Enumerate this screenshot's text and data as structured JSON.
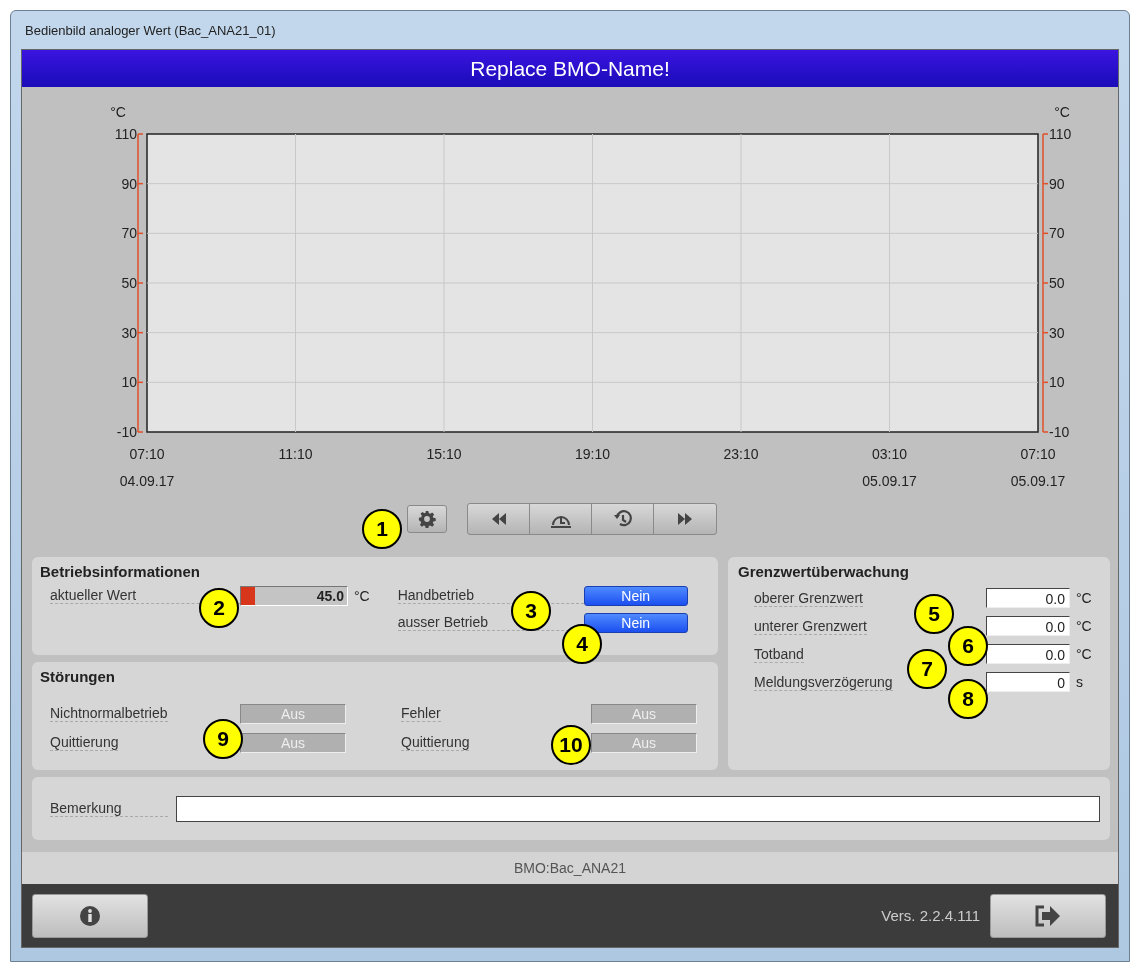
{
  "window": {
    "title": "Bedienbild analoger Wert (Bac_ANA21_01)"
  },
  "header": {
    "title": "Replace BMO-Name!"
  },
  "chart": {
    "unit_right": "°C",
    "right_yticks": [
      "110",
      "90",
      "70",
      "50",
      "30",
      "10",
      "-10"
    ],
    "chart_data": {
      "type": "line",
      "grid": true,
      "ylabel": "°C",
      "ylim": [
        -10,
        110
      ],
      "yticks": [
        -10,
        10,
        30,
        50,
        70,
        90,
        110
      ],
      "categories": [
        "07:10",
        "11:10",
        "15:10",
        "19:10",
        "23:10",
        "03:10",
        "07:10"
      ]
    },
    "date_labels": [
      {
        "text": "04.09.17",
        "kind": "first"
      },
      {
        "text": "05.09.17",
        "kind": "penultimate"
      },
      {
        "text": "05.09.17",
        "kind": "last"
      }
    ]
  },
  "betriebsinformationen": {
    "title": "Betriebsinformationen",
    "current_label": "aktueller Wert",
    "current_value": "45.0",
    "current_unit": "°C",
    "level": 0.13,
    "states": [
      {
        "label": "Handbetrieb",
        "value": "Nein"
      },
      {
        "label": "ausser Betrieb",
        "value": "Nein"
      }
    ]
  },
  "stoerungen": {
    "title": "Störungen",
    "items": [
      {
        "label": "Nichtnormalbetrieb",
        "value": "Aus"
      },
      {
        "label": "Quittierung",
        "value": "Aus"
      },
      {
        "label": "Fehler",
        "value": "Aus"
      },
      {
        "label": "Quittierung",
        "value": "Aus"
      }
    ]
  },
  "grenzwert": {
    "title": "Grenzwertüberwachung",
    "rows": [
      {
        "label": "oberer Grenzwert",
        "value": "0.0",
        "unit": "°C"
      },
      {
        "label": "unterer Grenzwert",
        "value": "0.0",
        "unit": "°C"
      },
      {
        "label": "Totband",
        "value": "0.0",
        "unit": "°C"
      },
      {
        "label": "Meldungsverzögerung",
        "value": "0",
        "unit": "s"
      }
    ]
  },
  "bemerkung": {
    "label": "Bemerkung"
  },
  "status_bar": "BMO:Bac_ANA21",
  "footer": {
    "version": "Vers. 2.2.4.111"
  },
  "callouts": [
    {
      "label": "1"
    },
    {
      "label": "2"
    },
    {
      "label": "3"
    },
    {
      "label": "4"
    },
    {
      "label": "5"
    },
    {
      "label": "6"
    },
    {
      "label": "7"
    },
    {
      "label": "8"
    },
    {
      "label": "9"
    },
    {
      "label": "10"
    }
  ]
}
